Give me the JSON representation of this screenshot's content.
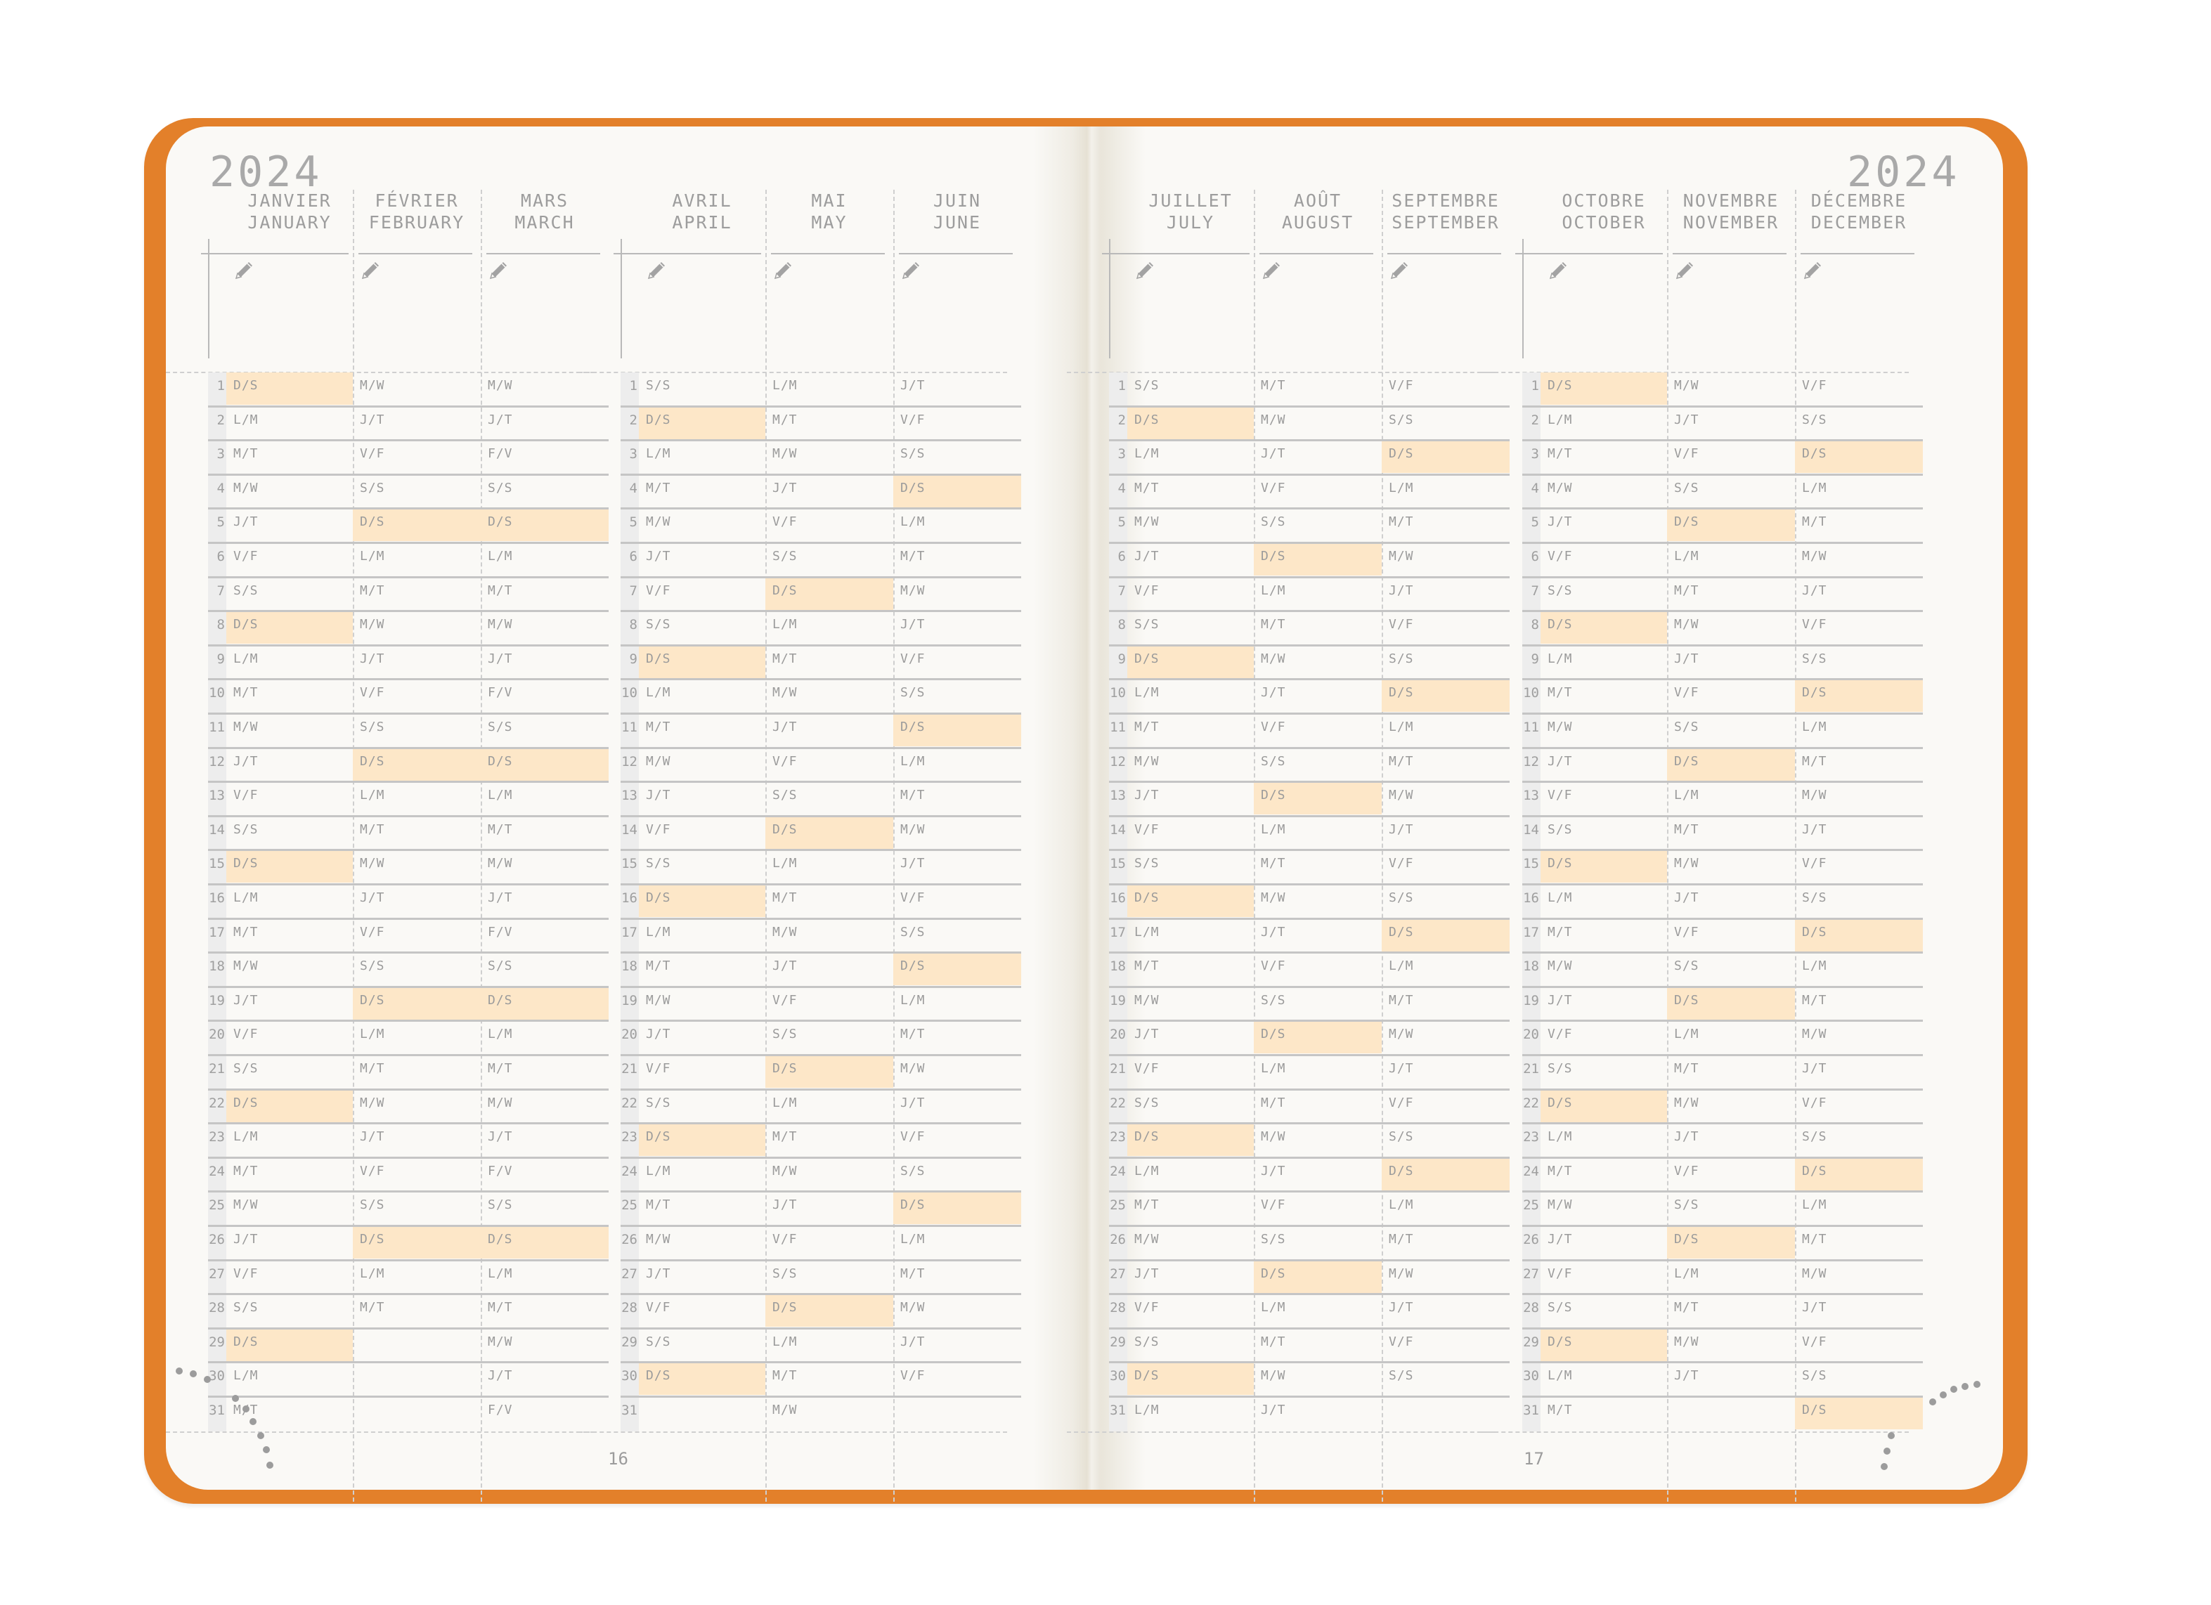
{
  "left_page": {
    "year": "2024",
    "page_number": "16",
    "quarters": [
      {
        "months": [
          {
            "fr": "JANVIER",
            "en": "JANUARY",
            "days": [
              "D/S",
              "L/M",
              "M/T",
              "M/W",
              "J/T",
              "V/F",
              "S/S",
              "D/S",
              "L/M",
              "M/T",
              "M/W",
              "J/T",
              "V/F",
              "S/S",
              "D/S",
              "L/M",
              "M/T",
              "M/W",
              "J/T",
              "V/F",
              "S/S",
              "D/S",
              "L/M",
              "M/T",
              "M/W",
              "J/T",
              "V/F",
              "S/S",
              "D/S",
              "L/M",
              "M/T"
            ]
          },
          {
            "fr": "FÉVRIER",
            "en": "FEBRUARY",
            "days": [
              "M/W",
              "J/T",
              "V/F",
              "S/S",
              "D/S",
              "L/M",
              "M/T",
              "M/W",
              "J/T",
              "V/F",
              "S/S",
              "D/S",
              "L/M",
              "M/T",
              "M/W",
              "J/T",
              "V/F",
              "S/S",
              "D/S",
              "L/M",
              "M/T",
              "M/W",
              "J/T",
              "V/F",
              "S/S",
              "D/S",
              "L/M",
              "M/T",
              "",
              "",
              ""
            ]
          },
          {
            "fr": "MARS",
            "en": "MARCH",
            "days": [
              "M/W",
              "J/T",
              "F/V",
              "S/S",
              "D/S",
              "L/M",
              "M/T",
              "M/W",
              "J/T",
              "F/V",
              "S/S",
              "D/S",
              "L/M",
              "M/T",
              "M/W",
              "J/T",
              "F/V",
              "S/S",
              "D/S",
              "L/M",
              "M/T",
              "M/W",
              "J/T",
              "F/V",
              "S/S",
              "D/S",
              "L/M",
              "M/T",
              "M/W",
              "J/T",
              "F/V"
            ]
          }
        ]
      },
      {
        "months": [
          {
            "fr": "AVRIL",
            "en": "APRIL",
            "days": [
              "S/S",
              "D/S",
              "L/M",
              "M/T",
              "M/W",
              "J/T",
              "V/F",
              "S/S",
              "D/S",
              "L/M",
              "M/T",
              "M/W",
              "J/T",
              "V/F",
              "S/S",
              "D/S",
              "L/M",
              "M/T",
              "M/W",
              "J/T",
              "V/F",
              "S/S",
              "D/S",
              "L/M",
              "M/T",
              "M/W",
              "J/T",
              "V/F",
              "S/S",
              "D/S",
              ""
            ]
          },
          {
            "fr": "MAI",
            "en": "MAY",
            "days": [
              "L/M",
              "M/T",
              "M/W",
              "J/T",
              "V/F",
              "S/S",
              "D/S",
              "L/M",
              "M/T",
              "M/W",
              "J/T",
              "V/F",
              "S/S",
              "D/S",
              "L/M",
              "M/T",
              "M/W",
              "J/T",
              "V/F",
              "S/S",
              "D/S",
              "L/M",
              "M/T",
              "M/W",
              "J/T",
              "V/F",
              "S/S",
              "D/S",
              "L/M",
              "M/T",
              "M/W"
            ]
          },
          {
            "fr": "JUIN",
            "en": "JUNE",
            "days": [
              "J/T",
              "V/F",
              "S/S",
              "D/S",
              "L/M",
              "M/T",
              "M/W",
              "J/T",
              "V/F",
              "S/S",
              "D/S",
              "L/M",
              "M/T",
              "M/W",
              "J/T",
              "V/F",
              "S/S",
              "D/S",
              "L/M",
              "M/T",
              "M/W",
              "J/T",
              "V/F",
              "S/S",
              "D/S",
              "L/M",
              "M/T",
              "M/W",
              "J/T",
              "V/F",
              ""
            ]
          }
        ]
      }
    ]
  },
  "right_page": {
    "year": "2024",
    "page_number": "17",
    "quarters": [
      {
        "months": [
          {
            "fr": "JUILLET",
            "en": "JULY",
            "days": [
              "S/S",
              "D/S",
              "L/M",
              "M/T",
              "M/W",
              "J/T",
              "V/F",
              "S/S",
              "D/S",
              "L/M",
              "M/T",
              "M/W",
              "J/T",
              "V/F",
              "S/S",
              "D/S",
              "L/M",
              "M/T",
              "M/W",
              "J/T",
              "V/F",
              "S/S",
              "D/S",
              "L/M",
              "M/T",
              "M/W",
              "J/T",
              "V/F",
              "S/S",
              "D/S",
              "L/M"
            ]
          },
          {
            "fr": "AOÛT",
            "en": "AUGUST",
            "days": [
              "M/T",
              "M/W",
              "J/T",
              "V/F",
              "S/S",
              "D/S",
              "L/M",
              "M/T",
              "M/W",
              "J/T",
              "V/F",
              "S/S",
              "D/S",
              "L/M",
              "M/T",
              "M/W",
              "J/T",
              "V/F",
              "S/S",
              "D/S",
              "L/M",
              "M/T",
              "M/W",
              "J/T",
              "V/F",
              "S/S",
              "D/S",
              "L/M",
              "M/T",
              "M/W",
              "J/T"
            ]
          },
          {
            "fr": "SEPTEMBRE",
            "en": "SEPTEMBER",
            "days": [
              "V/F",
              "S/S",
              "D/S",
              "L/M",
              "M/T",
              "M/W",
              "J/T",
              "V/F",
              "S/S",
              "D/S",
              "L/M",
              "M/T",
              "M/W",
              "J/T",
              "V/F",
              "S/S",
              "D/S",
              "L/M",
              "M/T",
              "M/W",
              "J/T",
              "V/F",
              "S/S",
              "D/S",
              "L/M",
              "M/T",
              "M/W",
              "J/T",
              "V/F",
              "S/S",
              ""
            ]
          }
        ]
      },
      {
        "months": [
          {
            "fr": "OCTOBRE",
            "en": "OCTOBER",
            "days": [
              "D/S",
              "L/M",
              "M/T",
              "M/W",
              "J/T",
              "V/F",
              "S/S",
              "D/S",
              "L/M",
              "M/T",
              "M/W",
              "J/T",
              "V/F",
              "S/S",
              "D/S",
              "L/M",
              "M/T",
              "M/W",
              "J/T",
              "V/F",
              "S/S",
              "D/S",
              "L/M",
              "M/T",
              "M/W",
              "J/T",
              "V/F",
              "S/S",
              "D/S",
              "L/M",
              "M/T"
            ]
          },
          {
            "fr": "NOVEMBRE",
            "en": "NOVEMBER",
            "days": [
              "M/W",
              "J/T",
              "V/F",
              "S/S",
              "D/S",
              "L/M",
              "M/T",
              "M/W",
              "J/T",
              "V/F",
              "S/S",
              "D/S",
              "L/M",
              "M/T",
              "M/W",
              "J/T",
              "V/F",
              "S/S",
              "D/S",
              "L/M",
              "M/T",
              "M/W",
              "J/T",
              "V/F",
              "S/S",
              "D/S",
              "L/M",
              "M/T",
              "M/W",
              "J/T",
              ""
            ]
          },
          {
            "fr": "DÉCEMBRE",
            "en": "DECEMBER",
            "days": [
              "V/F",
              "S/S",
              "D/S",
              "L/M",
              "M/T",
              "M/W",
              "J/T",
              "V/F",
              "S/S",
              "D/S",
              "L/M",
              "M/T",
              "M/W",
              "J/T",
              "V/F",
              "S/S",
              "D/S",
              "L/M",
              "M/T",
              "M/W",
              "J/T",
              "V/F",
              "S/S",
              "D/S",
              "L/M",
              "M/T",
              "M/W",
              "J/T",
              "V/F",
              "S/S",
              "D/S"
            ]
          }
        ]
      }
    ]
  },
  "highlight_day_label": "D/S",
  "colors": {
    "cover": "#e3802a",
    "paper": "#faf9f6",
    "sunday_highlight": "#fde7c8",
    "text": "#9b9b9b"
  },
  "icons": {
    "note": "pencil-icon"
  }
}
